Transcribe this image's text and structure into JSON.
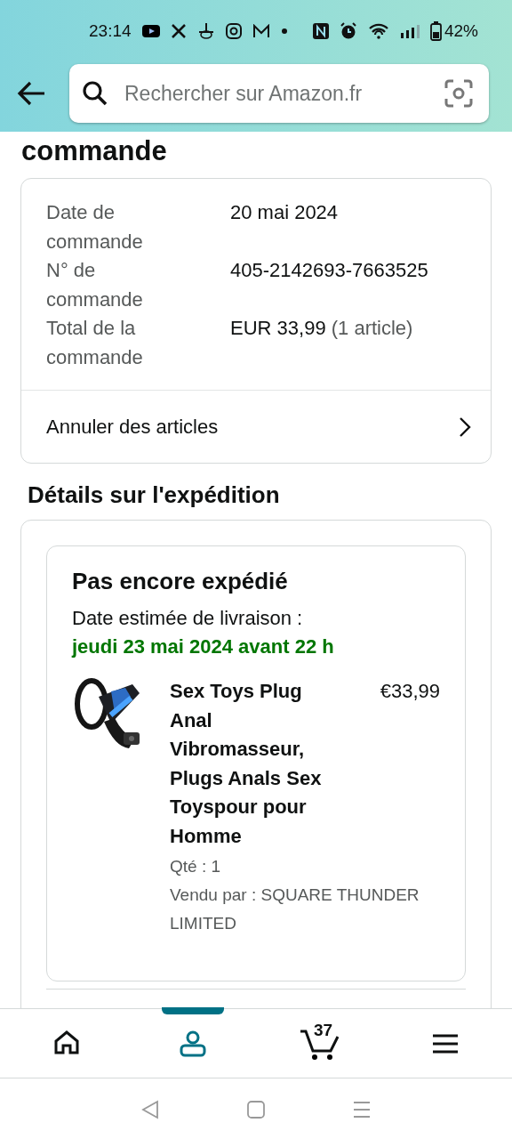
{
  "status_bar": {
    "time": "23:14",
    "battery": "42%"
  },
  "header": {
    "search": {
      "placeholder": "Rechercher sur Amazon.fr"
    }
  },
  "order_summary": {
    "heading": "commande",
    "rows": [
      {
        "label": "Date de commande",
        "value": "20 mai 2024"
      },
      {
        "label": "N° de commande",
        "value": "405-2142693-7663525"
      },
      {
        "label": "Total de la commande",
        "value": "EUR 33,99",
        "note": "(1 article)"
      }
    ],
    "action": "Annuler des articles"
  },
  "shipment": {
    "heading": "Détails sur l'expédition",
    "status": "Pas encore expédié",
    "delivery_label": "Date estimée de livraison :",
    "delivery_date": "jeudi 23 mai 2024 avant 22 h",
    "items": [
      {
        "kind": "picture",
        "title": "Sex Toys Plug Anal Vibromasseur, Plugs Anals Sex Toyspour pour Homme",
        "price": "€33,99",
        "quantity": "Qté : 1",
        "seller": "Vendu par : SQUARE THUNDER LIMITED"
      }
    ]
  },
  "bottom_nav": [
    {
      "kind": "home",
      "selected": false
    },
    {
      "kind": "account",
      "selected": true
    },
    {
      "kind": "cart",
      "badge": "37",
      "selected": false
    },
    {
      "kind": "menu",
      "selected": false
    }
  ]
}
